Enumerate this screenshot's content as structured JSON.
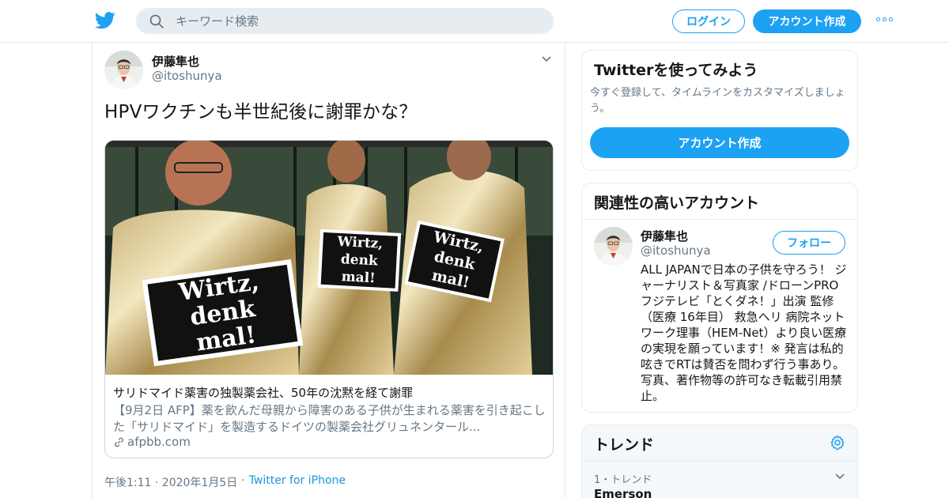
{
  "header": {
    "search_placeholder": "キーワード検索",
    "login_label": "ログイン",
    "signup_label": "アカウント作成",
    "accent_color": "#1da1f2"
  },
  "tweet": {
    "author_name": "伊藤隼也",
    "author_handle": "@itoshunya",
    "text": "HPVワクチンも半世紀後に謝罪かな？",
    "card": {
      "image_signs": [
        "Wirtz,",
        "denk",
        "mal!"
      ],
      "title": "サリドマイド薬害の独製薬会社、50年の沈黙を経て謝罪",
      "description": "【9月2日 AFP】薬を飲んだ母親から障害のある子供が生まれる薬害を引き起こした「サリドマイド」を製造するドイツの製薬会社グリュネンタール...",
      "domain": "afpbb.com"
    },
    "time": "午後1:11 · 2020年1月5日",
    "separator": "·",
    "source": "Twitter for iPhone"
  },
  "signup_panel": {
    "title": "Twitterを使ってみよう",
    "subtitle": "今すぐ登録して、タイムラインをカスタマイズしましょう。",
    "button_label": "アカウント作成"
  },
  "related_panel": {
    "title": "関連性の高いアカウント",
    "account": {
      "name": "伊藤隼也",
      "handle": "@itoshunya",
      "follow_label": "フォロー",
      "bio": "ALL JAPANで日本の子供を守ろう！ ジャーナリスト＆写真家 /ドローンPRO フジテレビ「とくダネ！」出演 監修（医療 16年目） 救急ヘリ 病院ネットワーク理事（HEM-Net）より良い医療の実現を願っています！※ 発言は私的呟きでRTは賛否を問わず行う事あり。写真、著作物等の許可なき転載引用禁止。"
    }
  },
  "trends_panel": {
    "title": "トレンド",
    "items": [
      {
        "meta": "1・トレンド",
        "name": "Emerson"
      }
    ]
  }
}
